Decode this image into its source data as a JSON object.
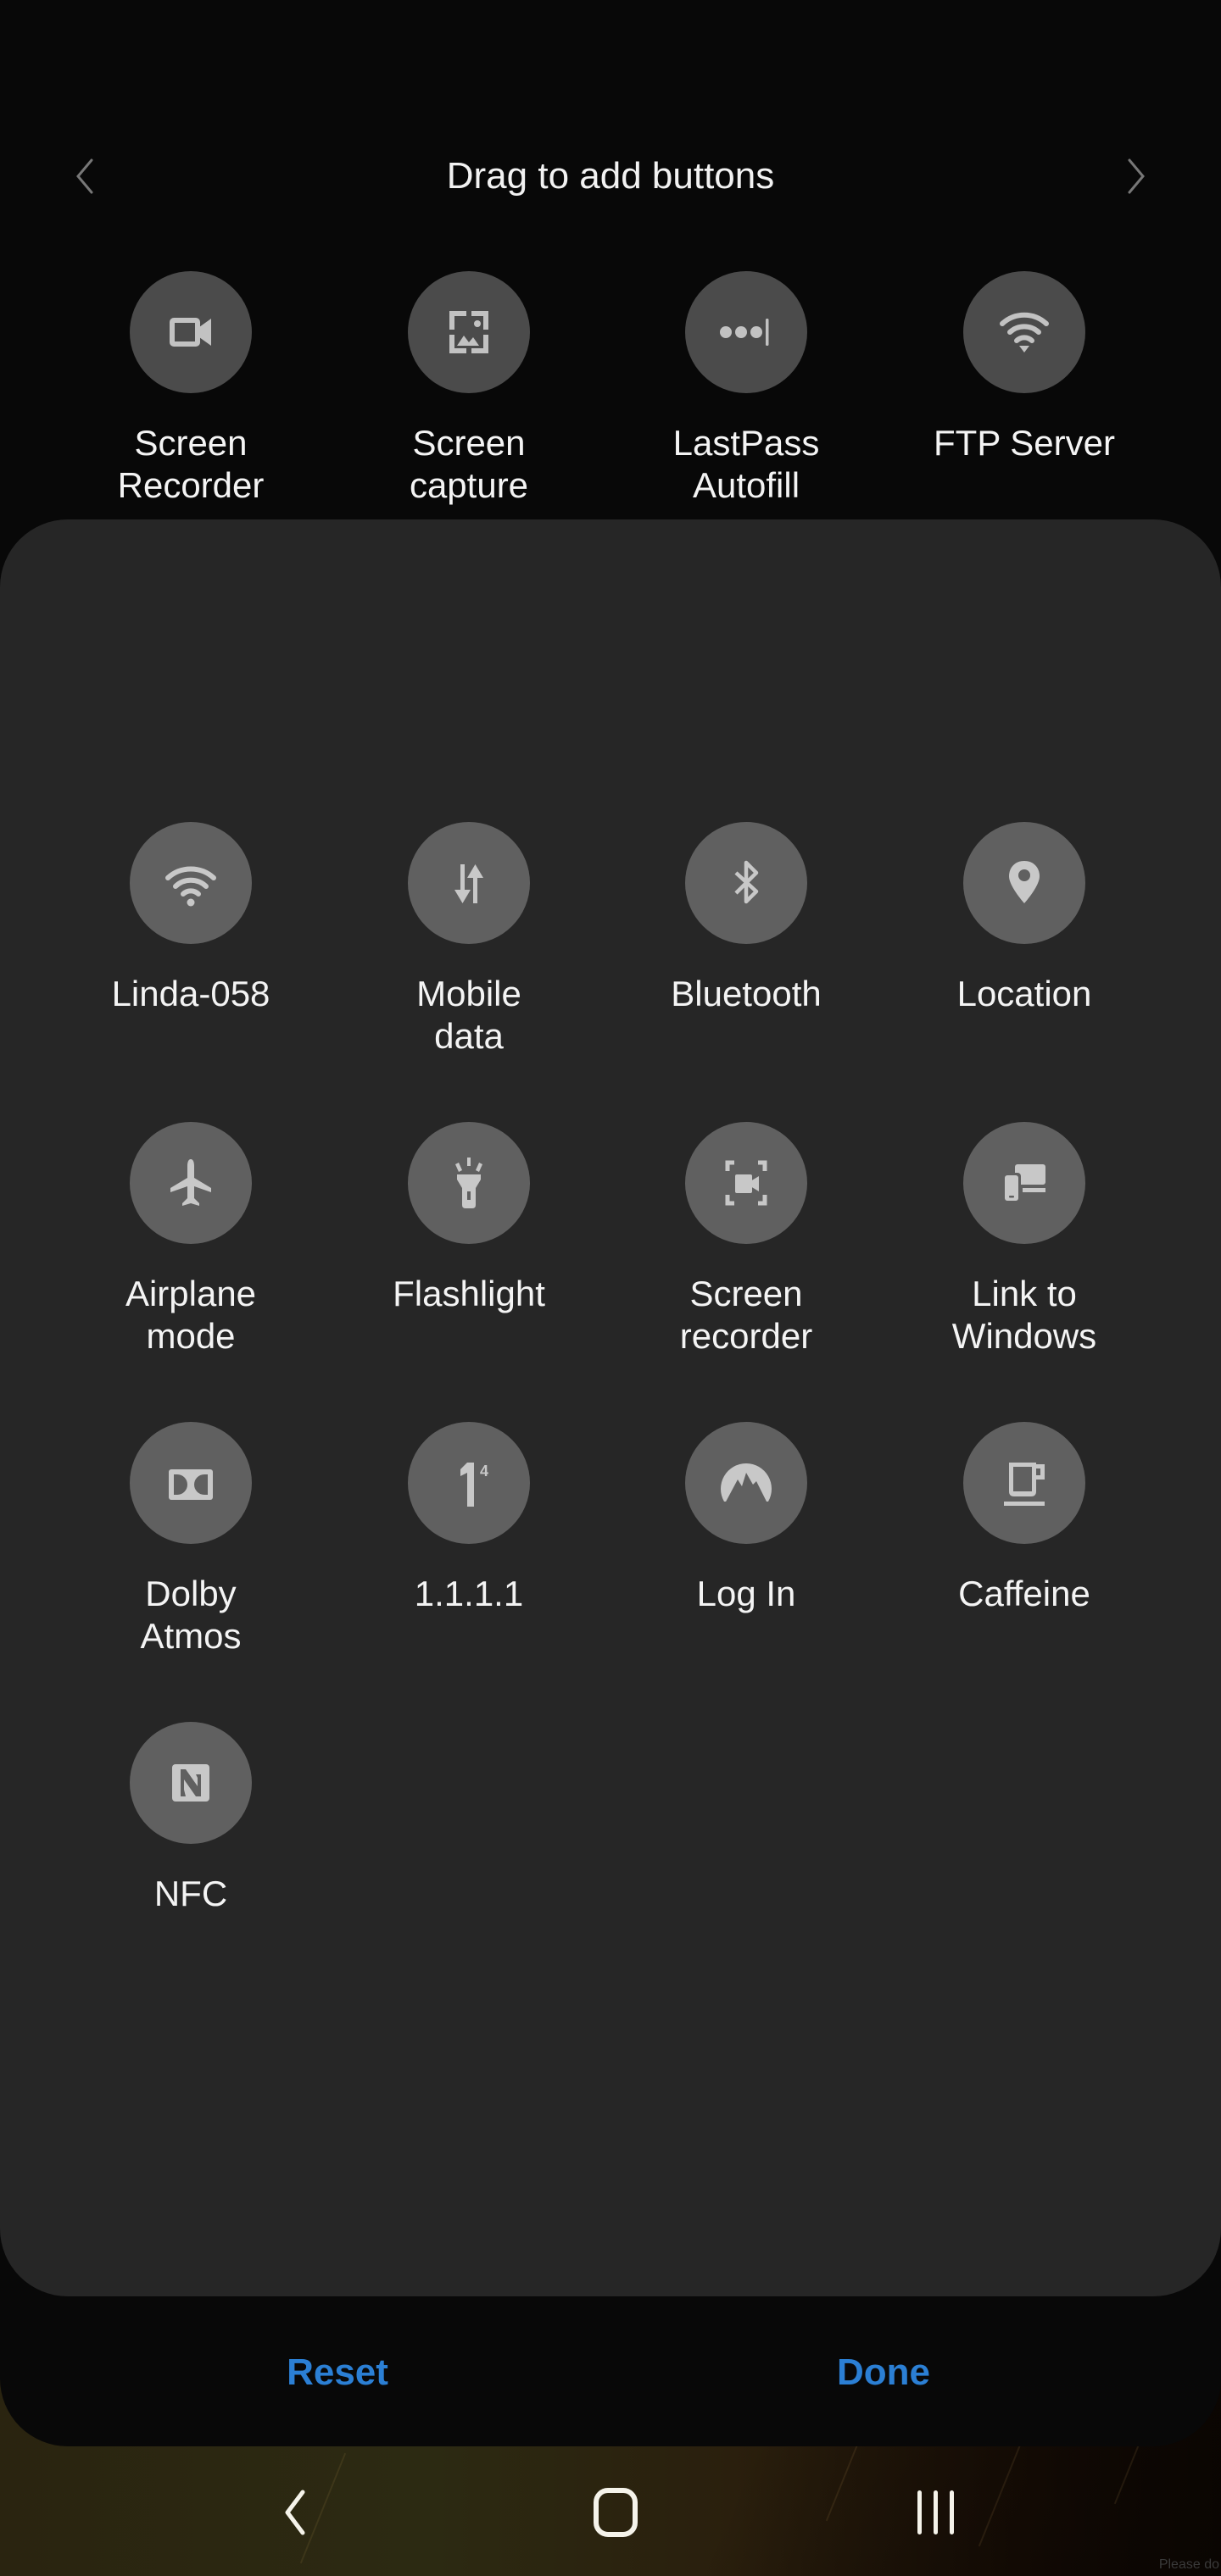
{
  "header": {
    "title": "Drag to add buttons",
    "prev_icon": "chevron-left-icon",
    "next_icon": "chevron-right-icon"
  },
  "available_buttons": [
    {
      "label": "Screen\nRecorder",
      "icon": "video-camera-icon"
    },
    {
      "label": "Screen\ncapture",
      "icon": "screenshot-icon"
    },
    {
      "label": "LastPass\nAutofill",
      "icon": "password-dots-icon"
    },
    {
      "label": "FTP Server",
      "icon": "wifi-icon"
    }
  ],
  "active_buttons": [
    {
      "label": "Linda-058",
      "icon": "wifi-icon"
    },
    {
      "label": "Mobile\ndata",
      "icon": "data-arrows-icon"
    },
    {
      "label": "Bluetooth",
      "icon": "bluetooth-icon"
    },
    {
      "label": "Location",
      "icon": "location-pin-icon"
    },
    {
      "label": "Airplane\nmode",
      "icon": "airplane-icon"
    },
    {
      "label": "Flashlight",
      "icon": "flashlight-icon"
    },
    {
      "label": "Screen\nrecorder",
      "icon": "screen-recorder-icon"
    },
    {
      "label": "Link to\nWindows",
      "icon": "link-to-windows-icon"
    },
    {
      "label": "Dolby\nAtmos",
      "icon": "dolby-icon"
    },
    {
      "label": "1.1.1.1",
      "icon": "one-one-one-one-icon"
    },
    {
      "label": "Log In",
      "icon": "nordvpn-mountain-icon"
    },
    {
      "label": "Caffeine",
      "icon": "coffee-cup-icon"
    },
    {
      "label": "NFC",
      "icon": "nfc-icon"
    }
  ],
  "actions": {
    "reset": "Reset",
    "done": "Done",
    "accent_color": "#2b7fd4"
  },
  "navbar": {
    "back_icon": "back-icon",
    "home_icon": "home-icon",
    "recents_icon": "recents-icon"
  },
  "watermark": "Please do"
}
